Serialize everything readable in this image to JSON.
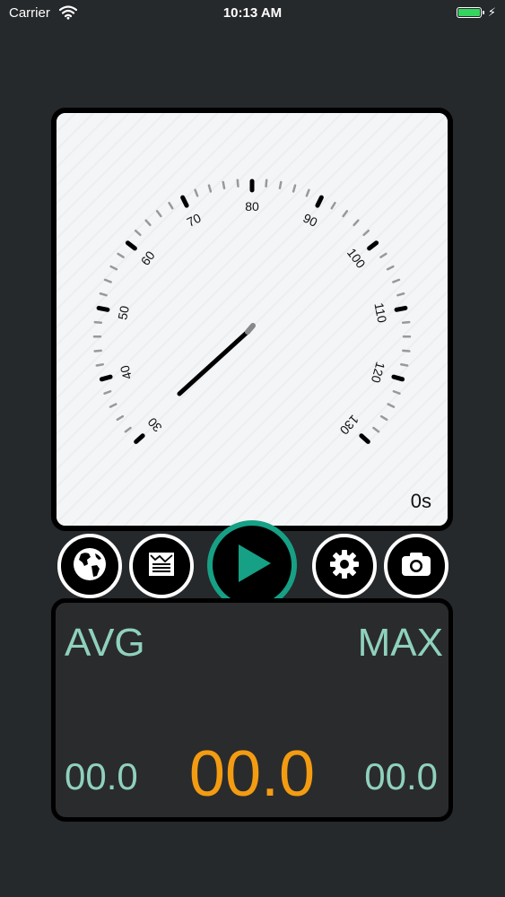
{
  "status_bar": {
    "carrier": "Carrier",
    "time": "10:13 AM",
    "battery_color": "#35d35f"
  },
  "gauge": {
    "tick_labels": [
      "30",
      "40",
      "50",
      "60",
      "70",
      "80",
      "90",
      "100",
      "110",
      "120",
      "130"
    ],
    "needle_value": 30,
    "elapsed": "0s",
    "needle_color": "#000000",
    "needle_tip_color": "#888888"
  },
  "toolbar": {
    "buttons": [
      {
        "name": "map-button",
        "icon": "globe-icon"
      },
      {
        "name": "log-button",
        "icon": "report-icon"
      },
      {
        "name": "play-button",
        "icon": "play-icon",
        "accent": "#16a085"
      },
      {
        "name": "settings-button",
        "icon": "gear-icon"
      },
      {
        "name": "camera-button",
        "icon": "camera-icon"
      }
    ]
  },
  "stats": {
    "avg_label": "AVG",
    "max_label": "MAX",
    "avg_value": "00.0",
    "current_value": "00.0",
    "max_value": "00.0",
    "label_color": "#8fd1bd",
    "current_color": "#f39c12"
  }
}
